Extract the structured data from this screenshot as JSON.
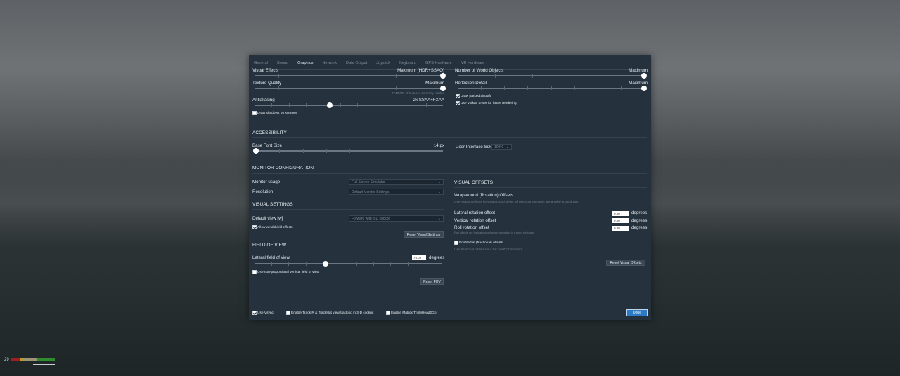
{
  "tabs": [
    "General",
    "Sound",
    "Graphics",
    "Network",
    "Data Output",
    "Joystick",
    "Keyboard",
    "GPS Hardware",
    "VR Hardware"
  ],
  "active_tab": "Graphics",
  "graphics": {
    "visual_effects": {
      "label": "Visual Effects",
      "value": "Maximum (HDR+SSAO)",
      "level": 1.0
    },
    "texture_quality": {
      "label": "Texture Quality",
      "value": "Maximum",
      "level": 1.0,
      "note": "2749 MB of textures currently loaded"
    },
    "antialiasing": {
      "label": "Antialiasing",
      "value": "2x SSAA+FXAA",
      "level": 0.4
    },
    "draw_shadows": {
      "label": "Draw shadows on scenery",
      "checked": false
    },
    "world_objects": {
      "label": "Number of World Objects",
      "value": "Maximum",
      "level": 1.0
    },
    "reflection_detail": {
      "label": "Reflection Detail",
      "value": "Maximum",
      "level": 1.0
    },
    "draw_parked": {
      "label": "Draw parked aircraft",
      "checked": true
    },
    "vulkan": {
      "label": "Use Vulkan driver for faster rendering",
      "checked": true
    }
  },
  "accessibility": {
    "title": "ACCESSIBILITY",
    "base_font": {
      "label": "Base Font Size",
      "value": "14 px",
      "level": 0.0
    },
    "ui_size": {
      "label": "User Interface Size",
      "value": "100%"
    }
  },
  "monitor": {
    "title": "MONITOR CONFIGURATION",
    "usage": {
      "label": "Monitor usage",
      "value": "Full Screen Simulator"
    },
    "resolution": {
      "label": "Resolution",
      "value": "Default Monitor Settings"
    }
  },
  "visual_settings": {
    "title": "VISUAL SETTINGS",
    "default_view": {
      "label": "Default view [w]",
      "value": "Forward with 3-D cockpit"
    },
    "windshield": {
      "label": "Allow windshield effects",
      "checked": true
    },
    "reset": "Reset Visual Settings"
  },
  "fov": {
    "title": "FIELD OF VIEW",
    "lateral": {
      "label": "Lateral field of view",
      "value": "75.02",
      "unit": "degrees",
      "level": 0.38
    },
    "nonprop": {
      "label": "Use non-proportional vertical field of view",
      "checked": false
    },
    "reset": "Reset FOV"
  },
  "offsets": {
    "title": "VISUAL OFFSETS",
    "wrap_title": "Wraparound (Rotation) Offsets",
    "wrap_hint": "Use rotation offsets for wraparound views, where your monitors are angled around you.",
    "lateral": {
      "label": "Lateral rotation offset",
      "value": "0.00",
      "unit": "degrees"
    },
    "vertical": {
      "label": "Vertical rotation offset",
      "value": "0.00",
      "unit": "degrees"
    },
    "roll": {
      "label": "Roll rotation offset",
      "value": "0.00",
      "unit": "degrees",
      "hint": "Roll offsets are typically used when a monitor is turned sideways"
    },
    "flat": {
      "label": "Enable flat (fractional) offsets",
      "checked": false,
      "hint": "Use fractional offsets for a flat \"wall\" of monitors."
    },
    "reset": "Reset Visual Offsets"
  },
  "footer": {
    "vsync": {
      "label": "Use Vsync",
      "checked": true
    },
    "trackir": {
      "label": "Enable TrackIR & TrackHat view tracking in 3-D cockpit",
      "checked": false
    },
    "matrox": {
      "label": "Enable Matrox TripleHead2Go",
      "checked": false
    },
    "done": "Done"
  },
  "hud": {
    "fps": "29"
  },
  "colors": {
    "accent": "#2a7bc4",
    "panel": "#25323e",
    "bar_red": "#a01e1e",
    "bar_yellow": "#b59a2c",
    "bar_green": "#2e8b2e"
  }
}
